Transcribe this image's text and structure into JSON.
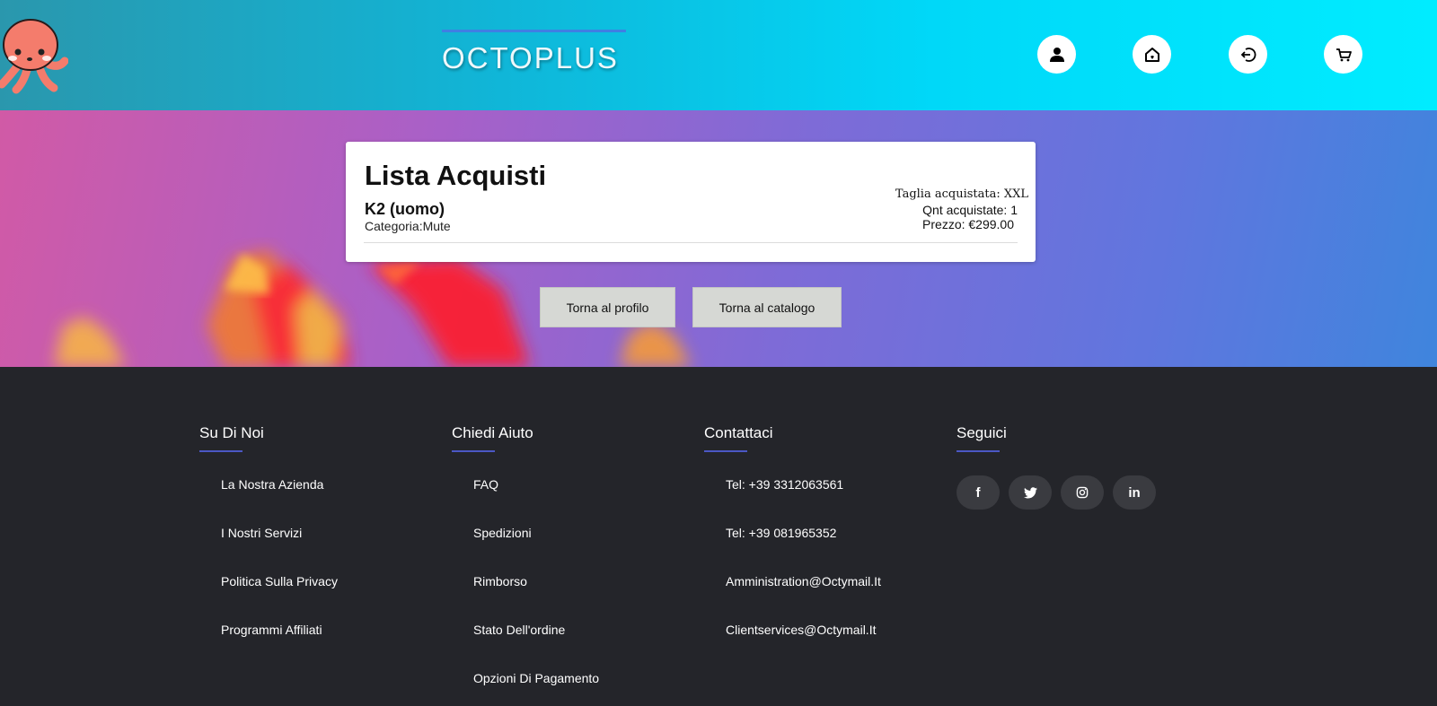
{
  "header": {
    "brand": "OCTOPLUS",
    "icons": [
      "user-icon",
      "home-icon",
      "logout-icon",
      "cart-icon"
    ]
  },
  "card": {
    "title": "Lista Acquisti",
    "item": {
      "name": "K2 (uomo)",
      "category": "Categoria:Mute",
      "size": "Taglia acquistata: XXL",
      "quantity": "Qnt acquistate: 1",
      "price": "Prezzo: €299.00"
    }
  },
  "actions": {
    "back_profile": "Torna al profilo",
    "back_catalog": "Torna al catalogo"
  },
  "footer": {
    "about": {
      "title": "Su Di Noi",
      "links": [
        "La Nostra Azienda",
        "I Nostri Servizi",
        "Politica Sulla Privacy",
        "Programmi Affiliati"
      ]
    },
    "help": {
      "title": "Chiedi Aiuto",
      "links": [
        "FAQ",
        "Spedizioni",
        "Rimborso",
        "Stato Dell'ordine",
        "Opzioni Di Pagamento"
      ]
    },
    "contact": {
      "title": "Contattaci",
      "links": [
        "Tel: +39 3312063561",
        "Tel: +39 081965352",
        "Amministration@Octymail.It",
        "Clientservices@Octymail.It"
      ]
    },
    "follow": {
      "title": "Seguici",
      "icons": [
        "facebook-icon",
        "twitter-icon",
        "instagram-icon",
        "linkedin-icon"
      ],
      "glyphs": [
        "f",
        "t",
        "◎",
        "in"
      ]
    }
  },
  "colors": {
    "header_start": "#2a97ad",
    "header_end": "#00ecff",
    "footer_bg": "#24252a",
    "accent": "#4b57c4",
    "button_bg": "#d6d8d4"
  }
}
